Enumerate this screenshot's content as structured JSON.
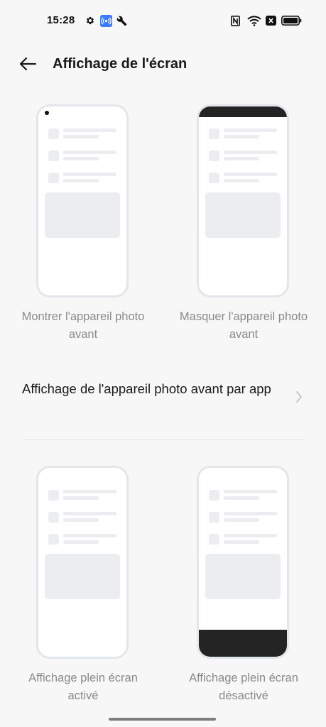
{
  "status_bar": {
    "time": "15:28",
    "left_icons": [
      "gear-icon",
      "hotspot-icon",
      "wrench-icon"
    ],
    "right_icons": [
      "nfc-icon",
      "wifi-icon",
      "no-sim-icon",
      "battery-icon"
    ],
    "hotspot_badge_color": "#3a7afe"
  },
  "header": {
    "title": "Affichage de l'écran",
    "back_icon": "arrow-left-icon"
  },
  "front_camera_options": [
    {
      "label": "Montrer l'appareil photo avant",
      "style": "camera-dot"
    },
    {
      "label": "Masquer l'appareil photo avant",
      "style": "black-top-bar"
    }
  ],
  "per_app_setting": {
    "label": "Affichage de l'appareil photo avant par app",
    "chevron_icon": "chevron-right-icon"
  },
  "fullscreen_options": [
    {
      "label": "Affichage plein écran activé",
      "style": "full"
    },
    {
      "label": "Affichage plein écran désactivé",
      "style": "black-bottom-bar"
    }
  ],
  "colors": {
    "background": "#f7f7f7",
    "phone_frame": "#e3e6ea",
    "placeholder": "#ecedf0",
    "dark_bar": "#242424",
    "caption_text": "#8a8a8a"
  }
}
